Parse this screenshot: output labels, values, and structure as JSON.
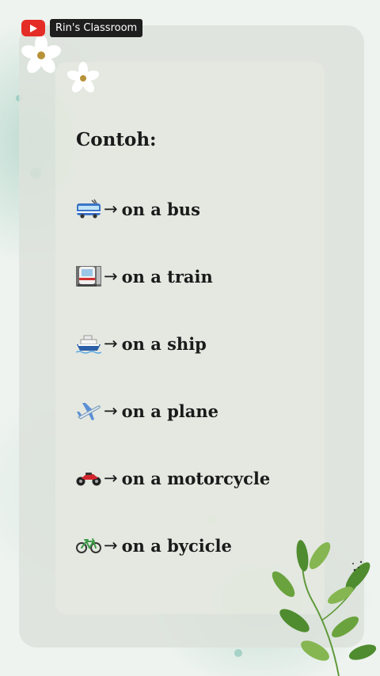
{
  "channel": {
    "name": "Rin's Classroom",
    "logo_icon": "youtube-play-icon"
  },
  "content": {
    "title": "Contoh:",
    "arrow": "→",
    "items": [
      {
        "icon": "bus-icon",
        "text": "on a bus"
      },
      {
        "icon": "train-icon",
        "text": "on a train"
      },
      {
        "icon": "ship-icon",
        "text": "on a ship"
      },
      {
        "icon": "plane-icon",
        "text": "on a plane"
      },
      {
        "icon": "motorcycle-icon",
        "text": "on a motorcycle"
      },
      {
        "icon": "bicycle-icon",
        "text": "on a bycicle"
      }
    ]
  },
  "colors": {
    "youtube_red": "#e52d27",
    "label_bg": "#1e1e1e",
    "text": "#1a1a1a",
    "leaf_green": "#5f9a3a"
  }
}
